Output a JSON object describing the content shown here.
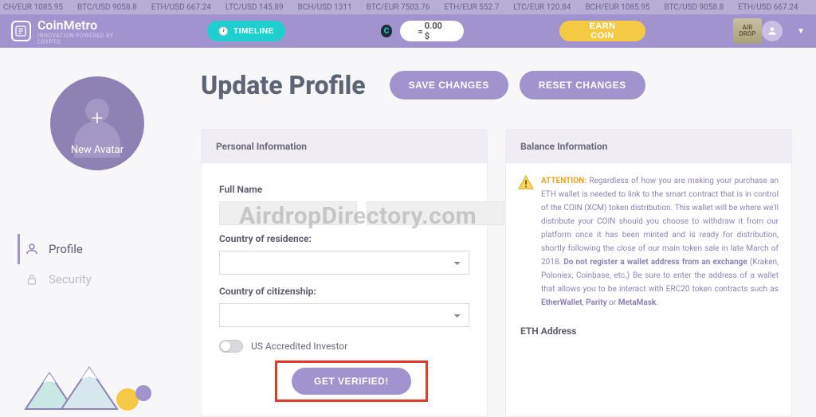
{
  "ticker": [
    "CH/EUR 1085.95",
    "BTC/USD 9058.8",
    "ETH/USD 667.24",
    "LTC/USD 145.89",
    "BCH/USD 1311",
    "BTC/EUR 7503.76",
    "ETH/EUR 552.7",
    "LTC/EUR 120.84",
    "BCH/EUR 1085.95",
    "BTC/USD 9058.8",
    "ETH/USD 667.24"
  ],
  "brand": {
    "name": "CoinMetro",
    "sub": "INNOVATION POWERED BY CRYPTO"
  },
  "topbar": {
    "timeline": "TIMELINE",
    "balance": "0.00 $",
    "earn": "EARN COIN",
    "airdrop1": "AIR",
    "airdrop2": "DROP"
  },
  "sidebar": {
    "avatar_label": "New Avatar",
    "nav": {
      "profile": "Profile",
      "security": "Security"
    }
  },
  "page": {
    "title": "Update Profile",
    "save": "SAVE CHANGES",
    "reset": "RESET CHANGES"
  },
  "personal": {
    "head": "Personal Information",
    "full_name_label": "Full Name",
    "first": "",
    "last": "",
    "country_res_label": "Country of residence:",
    "country_cit_label": "Country of citizenship:",
    "toggle_label": "US Accredited Investor",
    "verify": "GET VERIFIED!"
  },
  "balance": {
    "head": "Balance Information",
    "attention": "ATTENTION:",
    "body1": "Regardless of how you are making your purchase an ETH wallet is needed to link to the smart contract that is in control of the COIN (XCM) token distribution. This wallet will be where we'll distribute your COIN should you choose to withdraw it from our platform once it has been minted and is ready for distribution, shortly following the close of our main token sale in late March of 2018. ",
    "bold1": "Do not register a wallet address from an exchange",
    "body2": " (Kraken, Poloniex, Coinbase, etc.) Be sure to enter the address of a wallet that allows you to be interact with ERC20 token contracts such as ",
    "w1": "EtherWallet",
    "w2": "Parity",
    "w3": "MetaMask",
    "eth_head": "ETH Address"
  },
  "watermark": "AirdropDirectory.com"
}
